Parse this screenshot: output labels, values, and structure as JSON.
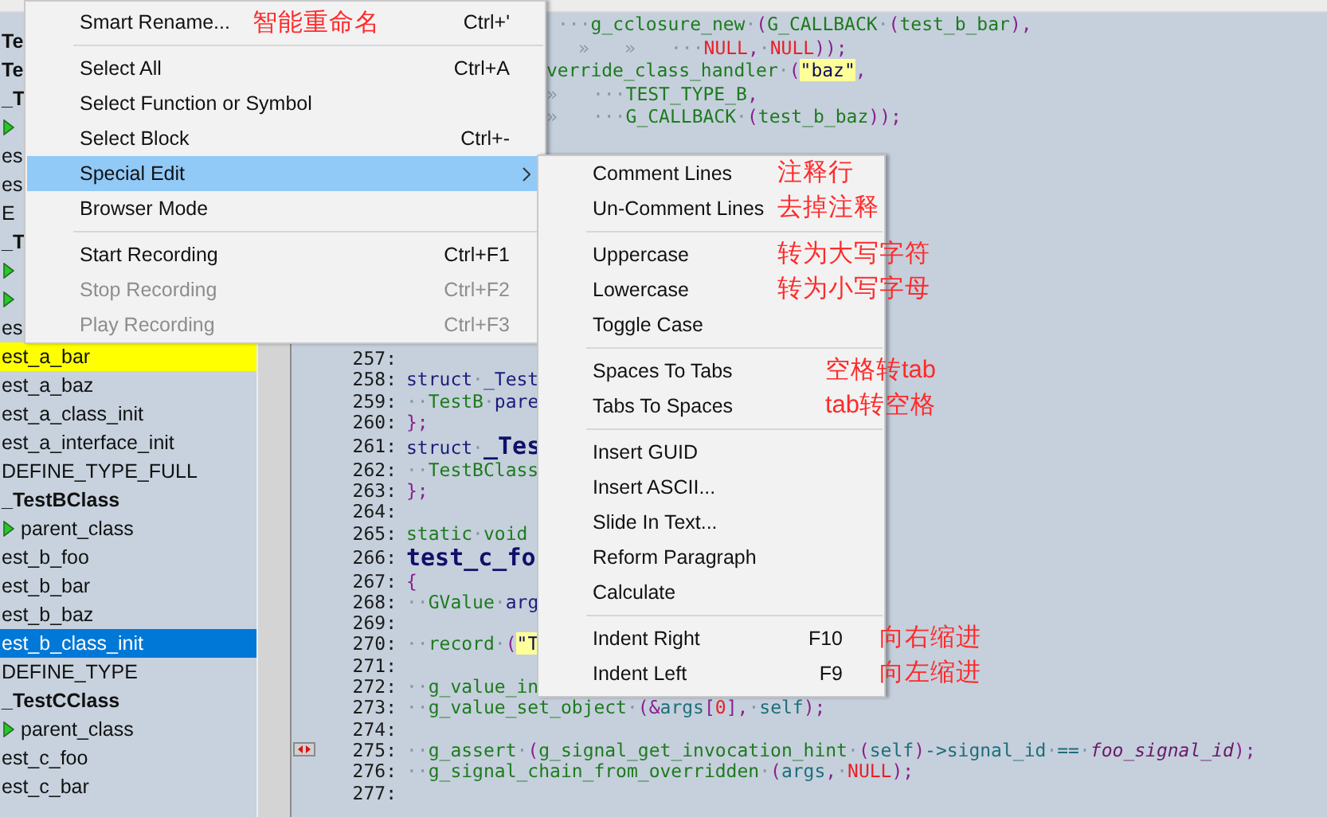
{
  "sidebar": {
    "items": [
      {
        "kind": "bold",
        "text": "Te",
        "selected": false,
        "highlighted": false
      },
      {
        "kind": "bold",
        "text": "Te",
        "selected": false,
        "highlighted": false
      },
      {
        "kind": "bold",
        "text": "_T",
        "selected": false,
        "highlighted": false
      },
      {
        "kind": "member",
        "selected": false,
        "highlighted": false
      },
      {
        "kind": "plain",
        "text": "es",
        "selected": false,
        "highlighted": false
      },
      {
        "kind": "plain",
        "text": "es",
        "selected": false,
        "highlighted": false
      },
      {
        "kind": "plain",
        "text": "E",
        "selected": false,
        "highlighted": false
      },
      {
        "kind": "bold",
        "text": "_T",
        "selected": false,
        "highlighted": false
      },
      {
        "kind": "member",
        "selected": false,
        "highlighted": false
      },
      {
        "kind": "member",
        "selected": false,
        "highlighted": false
      },
      {
        "kind": "plain",
        "text": "es",
        "selected": false,
        "highlighted": false
      },
      {
        "kind": "plain",
        "text": "est_a_bar",
        "selected": false,
        "highlighted": true
      },
      {
        "kind": "plain",
        "text": "est_a_baz",
        "selected": false,
        "highlighted": false
      },
      {
        "kind": "plain",
        "text": "est_a_class_init",
        "selected": false,
        "highlighted": false
      },
      {
        "kind": "plain",
        "text": "est_a_interface_init",
        "selected": false,
        "highlighted": false
      },
      {
        "kind": "plain",
        "text": "DEFINE_TYPE_FULL",
        "selected": false,
        "highlighted": false
      },
      {
        "kind": "bold",
        "text": "_TestBClass",
        "selected": false,
        "highlighted": false
      },
      {
        "kind": "member",
        "text": "parent_class",
        "selected": false,
        "highlighted": false
      },
      {
        "kind": "plain",
        "text": "est_b_foo",
        "selected": false,
        "highlighted": false
      },
      {
        "kind": "plain",
        "text": "est_b_bar",
        "selected": false,
        "highlighted": false
      },
      {
        "kind": "plain",
        "text": "est_b_baz",
        "selected": false,
        "highlighted": false
      },
      {
        "kind": "plain",
        "text": "est_b_class_init",
        "selected": true,
        "highlighted": false
      },
      {
        "kind": "plain",
        "text": "DEFINE_TYPE",
        "selected": false,
        "highlighted": false
      },
      {
        "kind": "bold",
        "text": "_TestCClass",
        "selected": false,
        "highlighted": false
      },
      {
        "kind": "member",
        "text": "parent_class",
        "selected": false,
        "highlighted": false
      },
      {
        "kind": "plain",
        "text": "est_c_foo",
        "selected": false,
        "highlighted": false
      },
      {
        "kind": "plain",
        "text": "est_c_bar",
        "selected": false,
        "highlighted": false
      }
    ]
  },
  "editor": {
    "top_lines": [
      {
        "tokens": [
          {
            "kind": "ws",
            "text": "···"
          },
          {
            "kind": "id",
            "text": "g_cclosure_new"
          },
          {
            "kind": "ws",
            "text": "·"
          },
          {
            "kind": "punct",
            "text": "("
          },
          {
            "kind": "id",
            "text": "G_CALLBACK"
          },
          {
            "kind": "ws",
            "text": "·"
          },
          {
            "kind": "punct",
            "text": "("
          },
          {
            "kind": "id",
            "text": "test_b_bar"
          },
          {
            "kind": "punct",
            "text": "),"
          }
        ]
      },
      {
        "tokens": [
          {
            "kind": "tab",
            "text": "»"
          },
          {
            "kind": "tab",
            "text": "»"
          },
          {
            "kind": "ws",
            "text": "···"
          },
          {
            "kind": "null",
            "text": "NULL"
          },
          {
            "kind": "punct",
            "text": ","
          },
          {
            "kind": "ws",
            "text": "·"
          },
          {
            "kind": "null",
            "text": "NULL"
          },
          {
            "kind": "punct",
            "text": "));"
          }
        ]
      },
      {
        "tokens": [
          {
            "kind": "id",
            "text": "verride_class_handler"
          },
          {
            "kind": "ws",
            "text": "·"
          },
          {
            "kind": "punct",
            "text": "("
          },
          {
            "kind": "str",
            "text": "\"baz\""
          },
          {
            "kind": "punct",
            "text": ","
          }
        ]
      },
      {
        "tokens": [
          {
            "kind": "tab",
            "text": "»"
          },
          {
            "kind": "ws",
            "text": "···"
          },
          {
            "kind": "id",
            "text": "TEST_TYPE_B"
          },
          {
            "kind": "punct",
            "text": ","
          }
        ]
      },
      {
        "tokens": [
          {
            "kind": "tab",
            "text": "»"
          },
          {
            "kind": "ws",
            "text": "···"
          },
          {
            "kind": "id",
            "text": "G_CALLBACK"
          },
          {
            "kind": "ws",
            "text": "·"
          },
          {
            "kind": "punct",
            "text": "("
          },
          {
            "kind": "id",
            "text": "test_b_baz"
          },
          {
            "kind": "punct",
            "text": "));"
          }
        ]
      }
    ],
    "lines": [
      {
        "number": "257:",
        "big": false,
        "marker": false
      },
      {
        "number": "258:",
        "big": false,
        "marker": false,
        "tokens": [
          {
            "kind": "kw",
            "text": "struct"
          },
          {
            "kind": "ws",
            "text": "·"
          },
          {
            "kind": "kw",
            "text": "_Test"
          }
        ]
      },
      {
        "number": "259:",
        "big": false,
        "marker": false,
        "tokens": [
          {
            "kind": "ws",
            "text": "··"
          },
          {
            "kind": "type",
            "text": "TestB"
          },
          {
            "kind": "ws",
            "text": "·"
          },
          {
            "kind": "kw",
            "text": "pare"
          }
        ]
      },
      {
        "number": "260:",
        "big": false,
        "marker": false,
        "tokens": [
          {
            "kind": "punct",
            "text": "};"
          }
        ]
      },
      {
        "number": "261:",
        "big": true,
        "marker": false,
        "tokens": [
          {
            "kind": "kw",
            "text": "struct"
          },
          {
            "kind": "ws",
            "text": "·"
          },
          {
            "kind": "title",
            "text": "_Tes"
          }
        ]
      },
      {
        "number": "262:",
        "big": false,
        "marker": false,
        "tokens": [
          {
            "kind": "ws",
            "text": "··"
          },
          {
            "kind": "type",
            "text": "TestBClass"
          }
        ]
      },
      {
        "number": "263:",
        "big": false,
        "marker": false,
        "tokens": [
          {
            "kind": "punct",
            "text": "};"
          }
        ]
      },
      {
        "number": "264:",
        "big": false,
        "marker": false
      },
      {
        "number": "265:",
        "big": false,
        "marker": false,
        "tokens": [
          {
            "kind": "type",
            "text": "static"
          },
          {
            "kind": "ws",
            "text": "·"
          },
          {
            "kind": "type",
            "text": "void"
          }
        ]
      },
      {
        "number": "266:",
        "big": true,
        "marker": false,
        "tokens": [
          {
            "kind": "title",
            "text": "test_c_fo"
          }
        ]
      },
      {
        "number": "267:",
        "big": false,
        "marker": false,
        "tokens": [
          {
            "kind": "punct",
            "text": "{"
          }
        ]
      },
      {
        "number": "268:",
        "big": false,
        "marker": false,
        "tokens": [
          {
            "kind": "ws",
            "text": "··"
          },
          {
            "kind": "type",
            "text": "GValue"
          },
          {
            "kind": "ws",
            "text": "·"
          },
          {
            "kind": "kw",
            "text": "arg"
          }
        ]
      },
      {
        "number": "269:",
        "big": false,
        "marker": false
      },
      {
        "number": "270:",
        "big": false,
        "marker": false,
        "tokens": [
          {
            "kind": "ws",
            "text": "··"
          },
          {
            "kind": "id",
            "text": "record"
          },
          {
            "kind": "ws",
            "text": "·"
          },
          {
            "kind": "punct",
            "text": "("
          },
          {
            "kind": "str",
            "text": "\"T"
          }
        ]
      },
      {
        "number": "271:",
        "big": false,
        "marker": false
      },
      {
        "number": "272:",
        "big": false,
        "marker": false,
        "tokens": [
          {
            "kind": "ws",
            "text": "··"
          },
          {
            "kind": "id",
            "text": "g_value_in"
          }
        ]
      },
      {
        "number": "273:",
        "big": false,
        "marker": false,
        "tokens": [
          {
            "kind": "ws",
            "text": "··"
          },
          {
            "kind": "id",
            "text": "g_value_set_object"
          },
          {
            "kind": "ws",
            "text": "·"
          },
          {
            "kind": "punct",
            "text": "(&"
          },
          {
            "kind": "var",
            "text": "args"
          },
          {
            "kind": "punct",
            "text": "["
          },
          {
            "kind": "null",
            "text": "0"
          },
          {
            "kind": "punct",
            "text": "],"
          },
          {
            "kind": "ws",
            "text": "·"
          },
          {
            "kind": "var",
            "text": "self"
          },
          {
            "kind": "punct",
            "text": ");"
          }
        ]
      },
      {
        "number": "274:",
        "big": false,
        "marker": false
      },
      {
        "number": "275:",
        "big": false,
        "marker": true,
        "tokens": [
          {
            "kind": "ws",
            "text": "··"
          },
          {
            "kind": "id",
            "text": "g_assert"
          },
          {
            "kind": "ws",
            "text": "·"
          },
          {
            "kind": "punct",
            "text": "("
          },
          {
            "kind": "id",
            "text": "g_signal_get_invocation_hint"
          },
          {
            "kind": "ws",
            "text": "·"
          },
          {
            "kind": "punct",
            "text": "("
          },
          {
            "kind": "var",
            "text": "self"
          },
          {
            "kind": "punct",
            "text": ")"
          },
          {
            "kind": "var",
            "text": "->signal_id"
          },
          {
            "kind": "ws",
            "text": "·"
          },
          {
            "kind": "var",
            "text": "=="
          },
          {
            "kind": "ws",
            "text": "·"
          },
          {
            "kind": "ital",
            "text": "foo_signal_id"
          },
          {
            "kind": "punct",
            "text": ");"
          }
        ]
      },
      {
        "number": "276:",
        "big": false,
        "marker": false,
        "tokens": [
          {
            "kind": "ws",
            "text": "··"
          },
          {
            "kind": "id",
            "text": "g_signal_chain_from_overridden"
          },
          {
            "kind": "ws",
            "text": "·"
          },
          {
            "kind": "punct",
            "text": "("
          },
          {
            "kind": "var",
            "text": "args"
          },
          {
            "kind": "punct",
            "text": ","
          },
          {
            "kind": "ws",
            "text": "·"
          },
          {
            "kind": "null",
            "text": "NULL"
          },
          {
            "kind": "punct",
            "text": ");"
          }
        ]
      },
      {
        "number": "277:",
        "big": false,
        "marker": false
      }
    ]
  },
  "context_menu": {
    "items": [
      {
        "kind": "item",
        "label": "Smart Rename...",
        "shortcut": "Ctrl+'",
        "note": "智能重命名",
        "selected": false,
        "disabled": false,
        "submenu": false
      },
      {
        "kind": "separator"
      },
      {
        "kind": "item",
        "label": "Select All",
        "shortcut": "Ctrl+A",
        "selected": false,
        "disabled": false,
        "submenu": false
      },
      {
        "kind": "item",
        "label": "Select Function or Symbol",
        "selected": false,
        "disabled": false,
        "submenu": false
      },
      {
        "kind": "item",
        "label": "Select Block",
        "shortcut": "Ctrl+-",
        "selected": false,
        "disabled": false,
        "submenu": false
      },
      {
        "kind": "item",
        "label": "Special Edit",
        "selected": true,
        "disabled": false,
        "submenu": true
      },
      {
        "kind": "item",
        "label": "Browser Mode",
        "selected": false,
        "disabled": false,
        "submenu": false
      },
      {
        "kind": "separator"
      },
      {
        "kind": "item",
        "label": "Start Recording",
        "shortcut": "Ctrl+F1",
        "selected": false,
        "disabled": false,
        "submenu": false
      },
      {
        "kind": "item",
        "label": "Stop Recording",
        "shortcut": "Ctrl+F2",
        "selected": false,
        "disabled": true,
        "submenu": false
      },
      {
        "kind": "item",
        "label": "Play Recording",
        "shortcut": "Ctrl+F3",
        "selected": false,
        "disabled": true,
        "submenu": false
      }
    ]
  },
  "submenu": {
    "items": [
      {
        "kind": "item",
        "label": "Comment Lines",
        "note": "注释行",
        "selected": false,
        "disabled": false
      },
      {
        "kind": "item",
        "label": "Un-Comment Lines",
        "note": "去掉注释",
        "selected": false,
        "disabled": false
      },
      {
        "kind": "separator"
      },
      {
        "kind": "item",
        "label": "Uppercase",
        "note": "转为大写字符",
        "selected": false,
        "disabled": false
      },
      {
        "kind": "item",
        "label": "Lowercase",
        "note": "转为小写字母",
        "selected": false,
        "disabled": false
      },
      {
        "kind": "item",
        "label": "Toggle Case",
        "selected": false,
        "disabled": false
      },
      {
        "kind": "separator"
      },
      {
        "kind": "item",
        "label": "Spaces To Tabs",
        "note": "空格转tab",
        "selected": false,
        "disabled": false
      },
      {
        "kind": "item",
        "label": "Tabs To Spaces",
        "note": "tab转空格",
        "selected": false,
        "disabled": false
      },
      {
        "kind": "separator"
      },
      {
        "kind": "item",
        "label": "Insert GUID",
        "selected": false,
        "disabled": false
      },
      {
        "kind": "item",
        "label": "Insert ASCII...",
        "selected": false,
        "disabled": false
      },
      {
        "kind": "item",
        "label": "Slide In Text...",
        "selected": false,
        "disabled": false
      },
      {
        "kind": "item",
        "label": "Reform Paragraph",
        "selected": false,
        "disabled": false
      },
      {
        "kind": "item",
        "label": "Calculate",
        "selected": false,
        "disabled": false
      },
      {
        "kind": "separator"
      },
      {
        "kind": "item",
        "label": "Indent Right",
        "shortcut": "F10",
        "note": "向右缩进",
        "selected": false,
        "disabled": false
      },
      {
        "kind": "item",
        "label": "Indent Left",
        "shortcut": "F9",
        "note": "向左缩进",
        "selected": false,
        "disabled": false
      }
    ]
  }
}
